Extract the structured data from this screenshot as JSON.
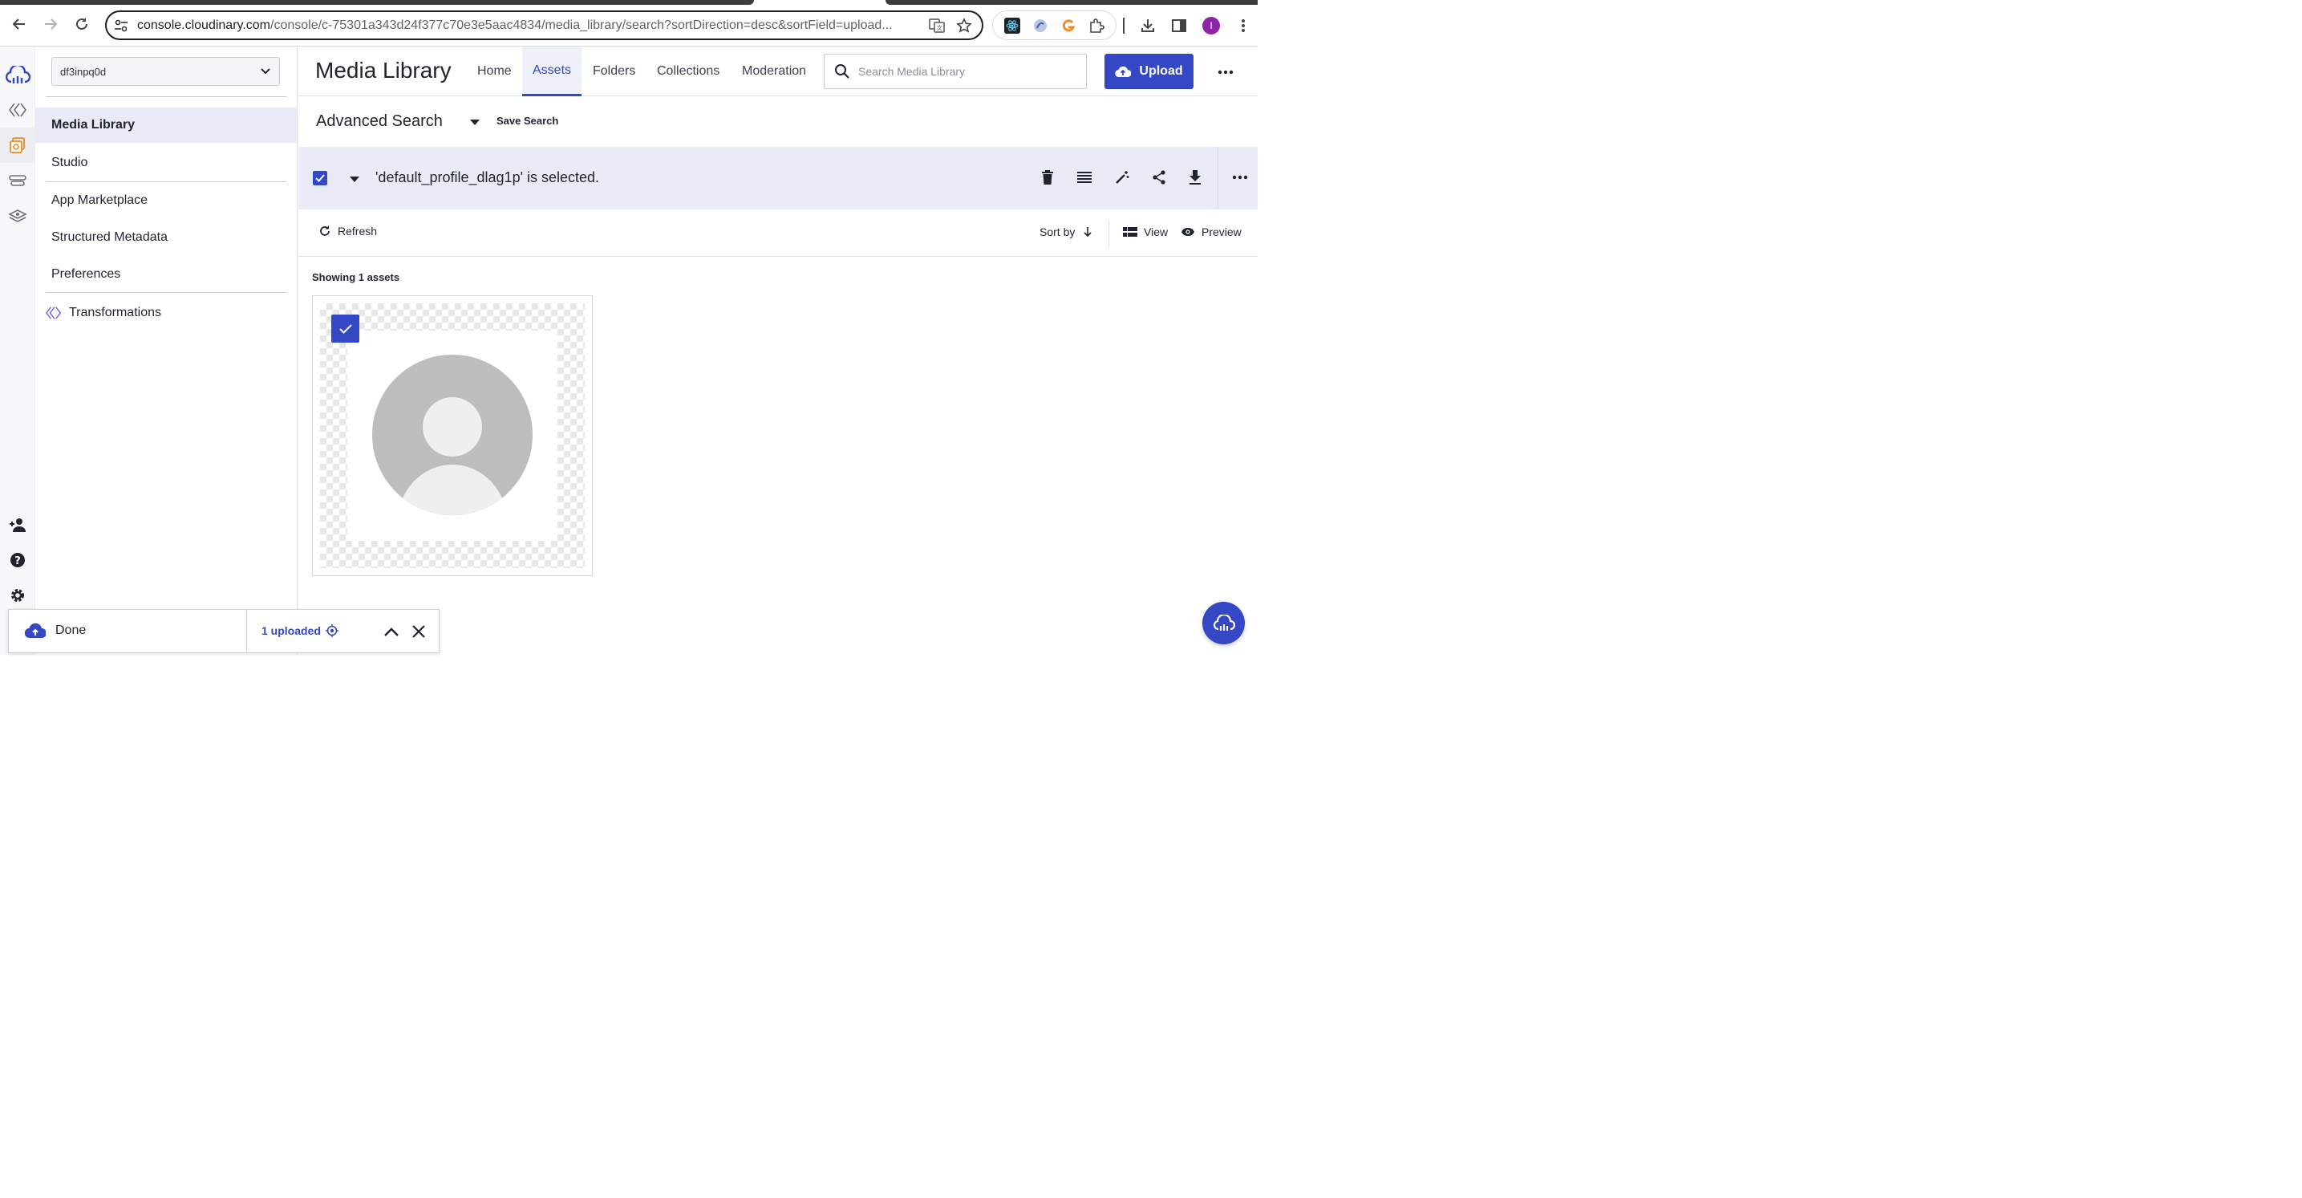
{
  "browser": {
    "url_host": "console.cloudinary.com",
    "url_path": "/console/c-75301a343d24f377c70e3e5aac4834/media_library/search?sortDirection=desc&sortField=upload...",
    "profile_initial": "I"
  },
  "sidebar": {
    "cloud_name": "df3inpq0d",
    "items": [
      {
        "label": "Media Library",
        "active": true
      },
      {
        "label": "Studio"
      },
      {
        "label": "App Marketplace"
      },
      {
        "label": "Structured Metadata"
      },
      {
        "label": "Preferences"
      },
      {
        "label": "Transformations"
      }
    ]
  },
  "header": {
    "title": "Media Library",
    "tabs": [
      {
        "label": "Home"
      },
      {
        "label": "Assets",
        "active": true
      },
      {
        "label": "Folders"
      },
      {
        "label": "Collections"
      },
      {
        "label": "Moderation"
      }
    ],
    "search_placeholder": "Search Media Library",
    "upload_label": "Upload"
  },
  "advanced": {
    "title": "Advanced Search",
    "save_label": "Save Search"
  },
  "selection": {
    "text": "'default_profile_dlag1p' is selected."
  },
  "toolbar": {
    "refresh_label": "Refresh",
    "sort_label": "Sort by",
    "view_label": "View",
    "preview_label": "Preview"
  },
  "results": {
    "count_text": "Showing 1 assets"
  },
  "toast": {
    "status": "Done",
    "uploaded": "1 uploaded"
  },
  "colors": {
    "accent": "#3448c5",
    "selection_bg": "#e9ebf6",
    "avatar_gray": "#bdbdbd"
  }
}
